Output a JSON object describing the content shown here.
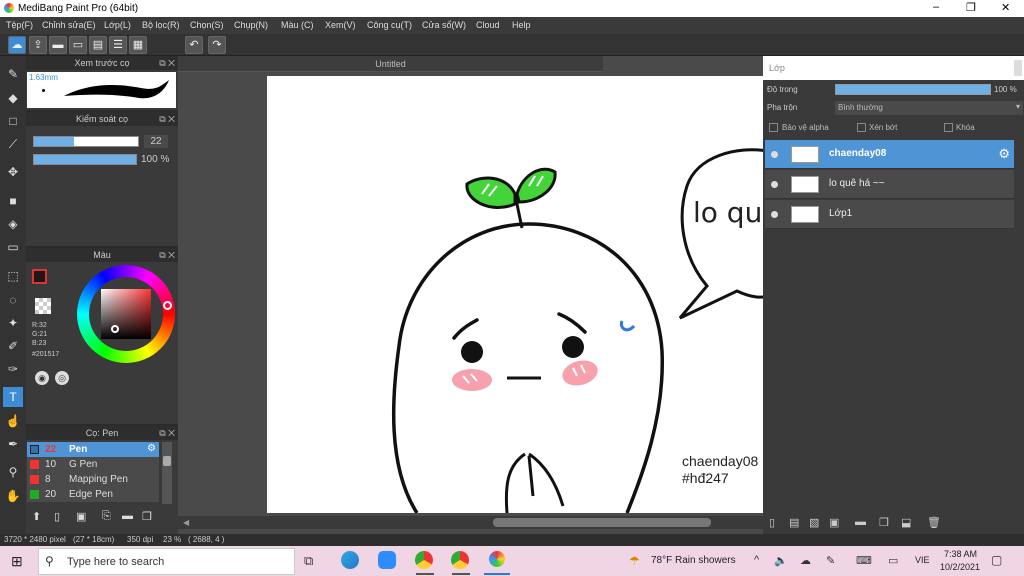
{
  "window": {
    "title": "MediBang Paint Pro (64bit)",
    "controls": [
      "–",
      "❐",
      "✕"
    ]
  },
  "menu": [
    "Tệp(F)",
    "Chỉnh sửa(E)",
    "Lớp(L)",
    "Bộ lọc(R)",
    "Chọn(S)",
    "Chụp(N)",
    "Màu (C)",
    "Xem(V)",
    "Công cụ(T)",
    "Cửa sổ(W)",
    "Cloud",
    "Help"
  ],
  "panels": {
    "brush_preview": {
      "title": "Xem trước cọ",
      "size_label": "1.63mm"
    },
    "brush_control": {
      "title": "Kiểm soát cọ",
      "size_value": "22",
      "opacity_value": "100 %",
      "size_fill": 0.38,
      "opacity_fill": 1.0
    },
    "color": {
      "title": "Màu",
      "r": "R:32",
      "g": "G:21",
      "b": "B:23",
      "hex": "#201517",
      "fg_color": "#201517"
    },
    "brush_list": {
      "title": "Cọ: Pen",
      "items": [
        {
          "size": "22",
          "name": "Pen",
          "color": "#3c8cd6"
        },
        {
          "size": "10",
          "name": "G Pen",
          "color": "#e33"
        },
        {
          "size": "8",
          "name": "Mapping Pen",
          "color": "#e33"
        },
        {
          "size": "20",
          "name": "Edge Pen",
          "color": "#2a2"
        }
      ]
    }
  },
  "canvas": {
    "tab_title": "Untitled",
    "speech_text": "lo qu",
    "signature_line1": "chaenday08",
    "signature_line2": "#hđ247"
  },
  "layers": {
    "title": "Lớp",
    "opacity_label": "Độ trong",
    "opacity_value": "100 %",
    "blend_label": "Pha trộn",
    "blend_value": "Bình thường",
    "protect_alpha": "Bảo vệ alpha",
    "clip": "Xén bớt",
    "lock": "Khóa",
    "items": [
      {
        "name": "chaenday08",
        "selected": true
      },
      {
        "name": "lo quê há ~~",
        "selected": false
      },
      {
        "name": "Lớp1",
        "selected": false
      }
    ]
  },
  "status": {
    "dimensions": "3720 * 2480 pixel",
    "cm": "(27 * 18cm)",
    "dpi": "350 dpi",
    "zoom": "23 %",
    "coords": "( 2688, 4 )"
  },
  "taskbar": {
    "search_placeholder": "Type here to search",
    "weather": "78°F  Rain showers",
    "lang": "VIE",
    "time": "7:38 AM",
    "date": "10/2/2021"
  }
}
